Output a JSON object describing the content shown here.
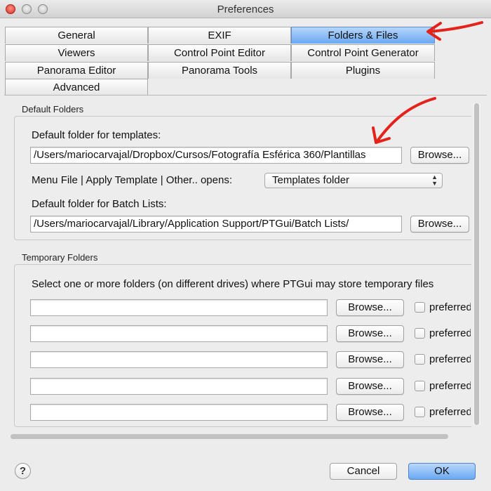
{
  "window": {
    "title": "Preferences"
  },
  "tabs": {
    "rows": [
      [
        "General",
        "EXIF",
        "Folders & Files"
      ],
      [
        "Viewers",
        "Control Point Editor",
        "Control Point Generator"
      ],
      [
        "Panorama Editor",
        "Panorama Tools",
        "Plugins"
      ],
      [
        "Advanced"
      ]
    ],
    "selected": "Folders & Files"
  },
  "default_folders": {
    "group_label": "Default Folders",
    "templates_label": "Default folder for templates:",
    "templates_value": "/Users/mariocarvajal/Dropbox/Cursos/Fotografía Esférica 360/Plantillas",
    "browse_label": "Browse...",
    "menu_label": "Menu File | Apply Template | Other.. opens:",
    "menu_selected": "Templates folder",
    "batch_label": "Default folder for Batch Lists:",
    "batch_value": "/Users/mariocarvajal/Library/Application Support/PTGui/Batch Lists/"
  },
  "temporary_folders": {
    "group_label": "Temporary Folders",
    "description": "Select one or more folders (on different drives) where PTGui may store temporary files",
    "browse_label": "Browse...",
    "preferred_label": "preferred",
    "rows": [
      {
        "value": "",
        "preferred": false
      },
      {
        "value": "",
        "preferred": false
      },
      {
        "value": "",
        "preferred": false
      },
      {
        "value": "",
        "preferred": false
      },
      {
        "value": "",
        "preferred": false
      }
    ]
  },
  "footer": {
    "help": "?",
    "cancel": "Cancel",
    "ok": "OK"
  },
  "colors": {
    "selected_tab": "#6aa8f2",
    "annotation_arrow": "#e3231b"
  }
}
